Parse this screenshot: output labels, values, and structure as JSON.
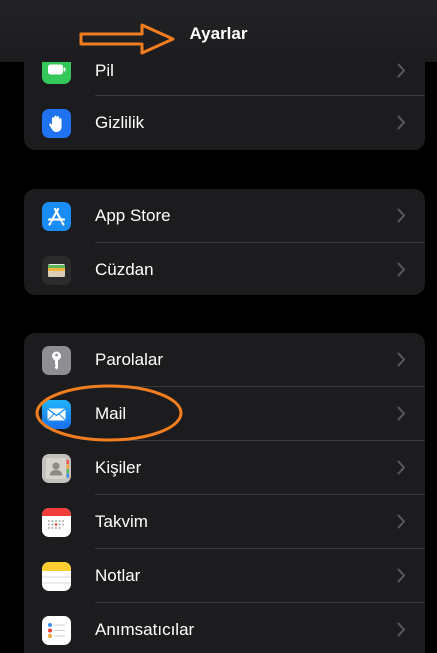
{
  "header": {
    "title": "Ayarlar"
  },
  "groups": [
    {
      "items": [
        {
          "label": "Pil",
          "icon": "battery-icon",
          "color": "#34c759"
        },
        {
          "label": "Gizlilik",
          "icon": "hand-icon",
          "color": "#1f72f0"
        }
      ]
    },
    {
      "items": [
        {
          "label": "App Store",
          "icon": "app-store-icon",
          "color": "#1a8cf5"
        },
        {
          "label": "Cüzdan",
          "icon": "wallet-icon",
          "color": "#2b2b2b"
        }
      ]
    },
    {
      "items": [
        {
          "label": "Parolalar",
          "icon": "key-icon",
          "color": "#8e8e93"
        },
        {
          "label": "Mail",
          "icon": "mail-icon",
          "color": "#1b8ff3"
        },
        {
          "label": "Kişiler",
          "icon": "contacts-icon",
          "color": "#c4c0bb"
        },
        {
          "label": "Takvim",
          "icon": "calendar-icon",
          "color": "#ffffff"
        },
        {
          "label": "Notlar",
          "icon": "notes-icon",
          "color": "#fecd2f"
        },
        {
          "label": "Anımsatıcılar",
          "icon": "reminders-icon",
          "color": "#ffffff"
        }
      ]
    }
  ],
  "annotations": {
    "arrow_color": "#f27e1f",
    "circle_color": "#f27e1f"
  }
}
